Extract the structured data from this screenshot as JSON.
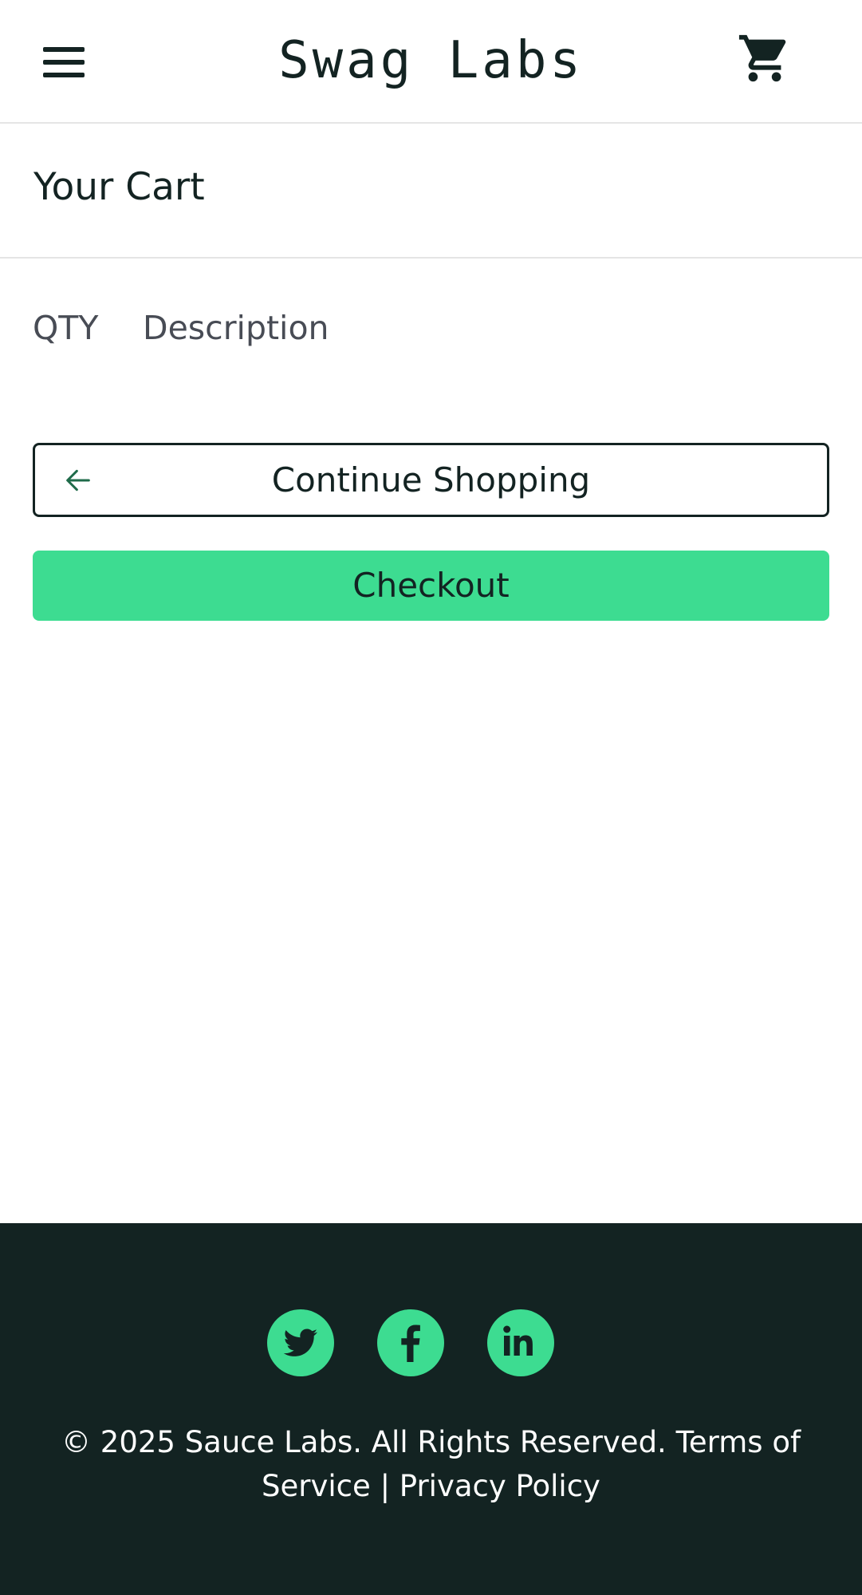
{
  "header": {
    "logo": "Swag Labs",
    "menu_icon": "hamburger-menu-icon",
    "cart_icon": "shopping-cart-icon"
  },
  "page": {
    "title": "Your Cart"
  },
  "cart_list": {
    "columns": [
      "QTY",
      "Description"
    ]
  },
  "actions": {
    "continue_shopping": "Continue Shopping",
    "continue_icon": "arrow-left-icon",
    "checkout": "Checkout"
  },
  "footer": {
    "social": [
      "twitter-icon",
      "facebook-icon",
      "linkedin-icon"
    ],
    "copyright": "© 2025 Sauce Labs. All Rights Reserved.",
    "terms": "Terms of Service",
    "separator": "|",
    "privacy": "Privacy Policy"
  },
  "colors": {
    "accent": "#3ddc91",
    "dark": "#132322",
    "muted_text": "#484c55",
    "divider": "#e5e5e5"
  }
}
